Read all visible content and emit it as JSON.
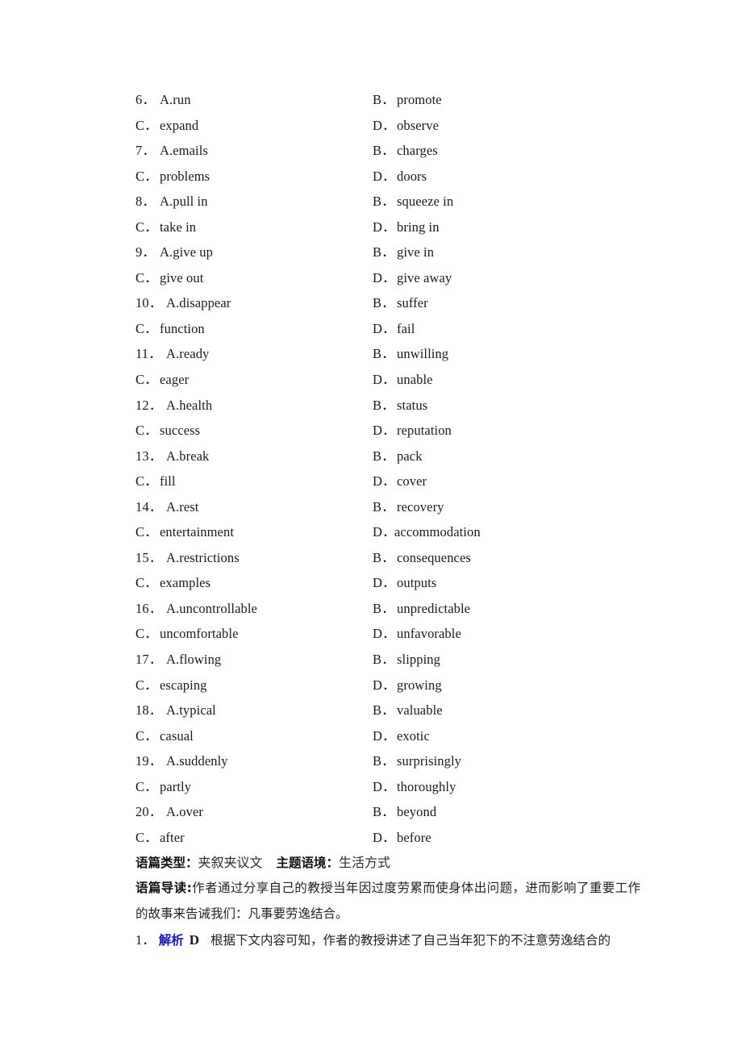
{
  "options": {
    "questions": [
      {
        "number": "6．",
        "a_label": "A.",
        "a_text": "run",
        "b_label": "B．",
        "b_text": "promote",
        "c_label": "C．",
        "c_text": "expand",
        "d_label": "D．",
        "d_text": "observe"
      },
      {
        "number": "7．",
        "a_label": "A.",
        "a_text": "emails",
        "b_label": "B．",
        "b_text": "charges",
        "c_label": "C．",
        "c_text": "problems",
        "d_label": "D．",
        "d_text": "doors"
      },
      {
        "number": "8．",
        "a_label": "A.",
        "a_text": "pull in",
        "b_label": "B．",
        "b_text": "squeeze in",
        "c_label": "C．",
        "c_text": "take in",
        "d_label": "D．",
        "d_text": "bring in"
      },
      {
        "number": "9．",
        "a_label": "A.",
        "a_text": "give up",
        "b_label": "B．",
        "b_text": "give in",
        "c_label": "C．",
        "c_text": "give out",
        "d_label": "D．",
        "d_text": "give away"
      },
      {
        "number": "10．",
        "a_label": "A.",
        "a_text": "disappear",
        "b_label": "B．",
        "b_text": "suffer",
        "c_label": "C．",
        "c_text": "function",
        "d_label": "D．",
        "d_text": "fail"
      },
      {
        "number": "11．",
        "a_label": "A.",
        "a_text": "ready",
        "b_label": "B．",
        "b_text": "unwilling",
        "c_label": "C．",
        "c_text": "eager",
        "d_label": "D．",
        "d_text": "unable"
      },
      {
        "number": "12．",
        "a_label": "A.",
        "a_text": "health",
        "b_label": "B．",
        "b_text": "status",
        "c_label": "C．",
        "c_text": "success",
        "d_label": "D．",
        "d_text": "reputation"
      },
      {
        "number": "13．",
        "a_label": "A.",
        "a_text": "break",
        "b_label": "B．",
        "b_text": "pack",
        "c_label": "C．",
        "c_text": "fill",
        "d_label": "D．",
        "d_text": "cover"
      },
      {
        "number": "14．",
        "a_label": "A.",
        "a_text": "rest",
        "b_label": "B．",
        "b_text": "recovery",
        "c_label": "C．",
        "c_text": "entertainment",
        "d_label": "D．",
        "d_text": "accommodation"
      },
      {
        "number": "15．",
        "a_label": "A.",
        "a_text": "restrictions",
        "b_label": "B．",
        "b_text": "consequences",
        "c_label": "C．",
        "c_text": "examples",
        "d_label": "D．",
        "d_text": "outputs"
      },
      {
        "number": "16．",
        "a_label": "A.",
        "a_text": "uncontrollable",
        "b_label": "B．",
        "b_text": "unpredictable",
        "c_label": "C．",
        "c_text": "uncomfortable",
        "d_label": "D．",
        "d_text": "unfavorable"
      },
      {
        "number": "17．",
        "a_label": "A.",
        "a_text": "flowing",
        "b_label": "B．",
        "b_text": "slipping",
        "c_label": "C．",
        "c_text": "escaping",
        "d_label": "D．",
        "d_text": "growing"
      },
      {
        "number": "18．",
        "a_label": "A.",
        "a_text": "typical",
        "b_label": "B．",
        "b_text": "valuable",
        "c_label": "C．",
        "c_text": "casual",
        "d_label": "D．",
        "d_text": "exotic"
      },
      {
        "number": "19．",
        "a_label": "A.",
        "a_text": "suddenly",
        "b_label": "B．",
        "b_text": "surprisingly",
        "c_label": "C．",
        "c_text": "partly",
        "d_label": "D．",
        "d_text": "thoroughly"
      },
      {
        "number": "20．",
        "a_label": "A.",
        "a_text": "over",
        "b_label": "B．",
        "b_text": "beyond",
        "c_label": "C．",
        "c_text": "after",
        "d_label": "D．",
        "d_text": "before"
      }
    ]
  },
  "notes": {
    "genre_label": "语篇类型：",
    "genre_value": "夹叙夹议文",
    "topic_label": "主题语境：",
    "topic_value": "生活方式",
    "guide_label": "语篇导读:",
    "guide_text": "作者通过分享自己的教授当年因过度劳累而使身体出问题，进而影响了重要工作的故事来告诫我们：凡事要劳逸结合。"
  },
  "answer": {
    "number": "1．",
    "key_label": "解析",
    "letter": "D",
    "explanation": "根据下文内容可知，作者的教授讲述了自己当年犯下的不注意劳逸结合的"
  },
  "colors": {
    "key_blue": "#1a16cf",
    "text": "#1a1a1a",
    "background": "#ffffff"
  }
}
